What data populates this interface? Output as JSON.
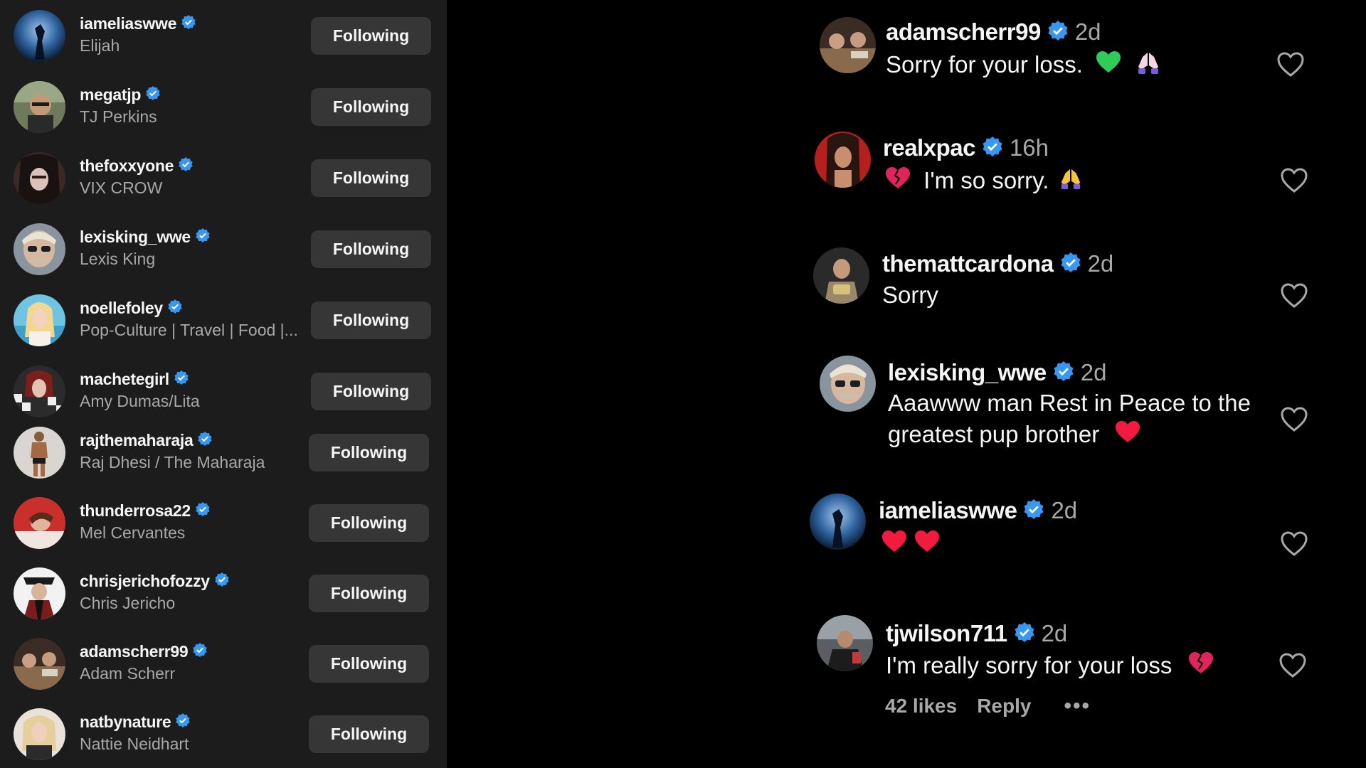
{
  "following_list": {
    "button_label": "Following",
    "items": [
      {
        "username": "iameliaswwe",
        "name": "Elijah"
      },
      {
        "username": "megatjp",
        "name": "TJ Perkins"
      },
      {
        "username": "thefoxxyone",
        "name": "VIX CROW"
      },
      {
        "username": "lexisking_wwe",
        "name": "Lexis King"
      },
      {
        "username": "noellefoley",
        "name": "Pop-Culture | Travel | Food |..."
      },
      {
        "username": "machetegirl",
        "name": "Amy Dumas/Lita"
      },
      {
        "username": "rajthemaharaja",
        "name": "Raj Dhesi / The Maharaja"
      },
      {
        "username": "thunderrosa22",
        "name": "Mel Cervantes"
      },
      {
        "username": "chrisjerichofozzy",
        "name": "Chris Jericho"
      },
      {
        "username": "adamscherr99",
        "name": "Adam Scherr"
      },
      {
        "username": "natbynature",
        "name": "Nattie Neidhart"
      }
    ]
  },
  "comments": [
    {
      "username": "adamscherr99",
      "time": "2d",
      "text": "Sorry for your loss.",
      "emojis": [
        "green-heart",
        "folded-hands-light"
      ]
    },
    {
      "username": "realxpac",
      "time": "16h",
      "text": "I'm so sorry.",
      "emojis": [
        "broken-heart",
        "folded-hands"
      ]
    },
    {
      "username": "themattcardona",
      "time": "2d",
      "text": "Sorry",
      "emojis": []
    },
    {
      "username": "lexisking_wwe",
      "time": "2d",
      "text_line1": "Aaawww man Rest in Peace to the",
      "text_line2": "greatest pup brother",
      "emojis": [
        "red-heart"
      ]
    },
    {
      "username": "iameliaswwe",
      "time": "2d",
      "text": "",
      "emojis": [
        "red-heart",
        "red-heart"
      ]
    },
    {
      "username": "tjwilson711",
      "time": "2d",
      "text": "I'm really sorry for your loss",
      "emojis": [
        "broken-heart"
      ]
    }
  ],
  "comment_meta": {
    "likes": "42 likes",
    "reply": "Reply",
    "more": "•••"
  },
  "colors": {
    "left_panel_bg": "#1c1c1c",
    "page_bg": "#000000",
    "button_bg": "#363636",
    "verified_blue": "#3897f0",
    "secondary_text": "#a8a8a8"
  }
}
